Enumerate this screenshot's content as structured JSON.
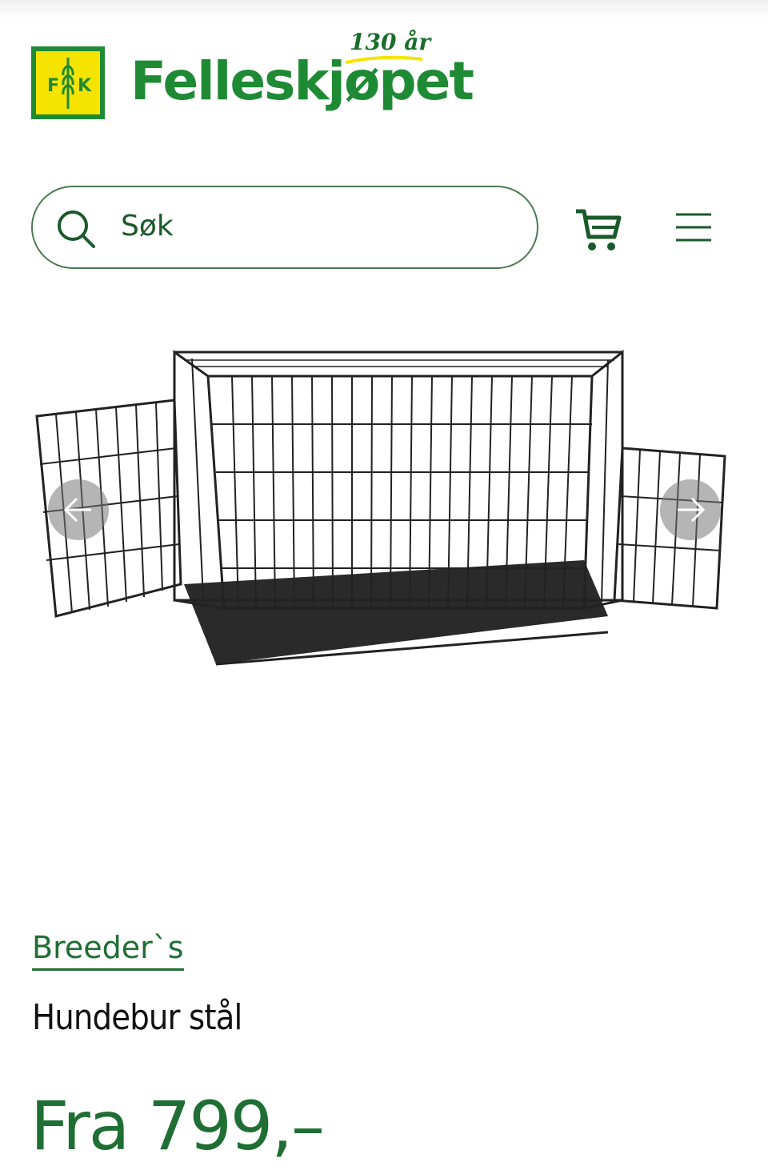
{
  "header": {
    "logo_letters": "F K",
    "brand_name": "Felleskjøpet",
    "anniversary": "130 år",
    "search": {
      "placeholder": "Søk"
    },
    "icons": {
      "search": "search-icon",
      "cart": "cart-icon",
      "menu": "hamburger-menu-icon"
    },
    "brand_color": "#1f8a34",
    "logo_yellow": "#f4e400"
  },
  "product": {
    "brand": "Breeder`s",
    "name": "Hundebur stål",
    "price": "Fra 799,–",
    "image_alt": "dog-crate-image",
    "gallery_nav": {
      "prev_icon": "arrow-left-icon",
      "next_icon": "arrow-right-icon"
    }
  }
}
